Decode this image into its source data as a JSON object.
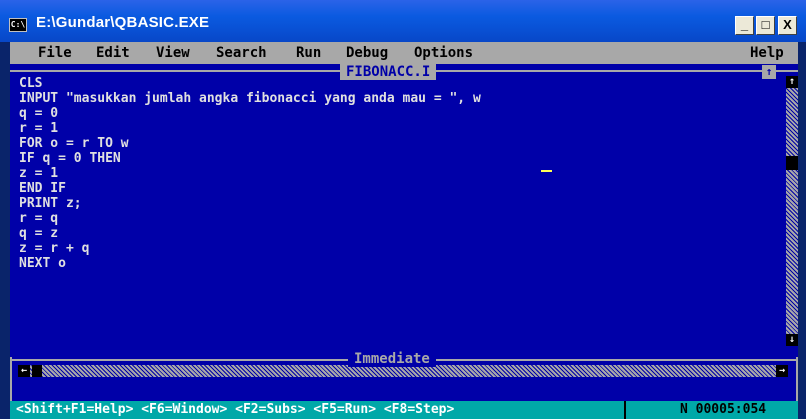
{
  "window": {
    "title": "E:\\Gundar\\QBASIC.EXE",
    "icon_text": "C:\\",
    "minimize": "_",
    "maximize": "□",
    "close": "X"
  },
  "menu": {
    "items": [
      "File",
      "Edit",
      "View",
      "Search",
      "Run",
      "Debug",
      "Options"
    ],
    "help": "Help"
  },
  "editor": {
    "filename": "FIBONACC.I",
    "maximize_glyph": "↑",
    "lines": [
      "CLS",
      "INPUT \"masukkan jumlah angka fibonacci yang anda mau = \", w",
      "q = 0",
      "r = 1",
      "FOR o = r TO w",
      "IF q = 0 THEN",
      "z = 1",
      "END IF",
      "PRINT z;",
      "r = q",
      "q = z",
      "z = r + q",
      "NEXT o"
    ],
    "scroll_up": "↑",
    "scroll_down": "↓",
    "scroll_left": "←",
    "scroll_right": "→"
  },
  "immediate": {
    "title": "Immediate"
  },
  "status": {
    "keys": "<Shift+F1=Help> <F6=Window> <F2=Subs> <F5=Run> <F8=Step>",
    "position": "N 00005:054"
  },
  "colors": {
    "background": "#0000a8",
    "menu": "#a8a8a8",
    "statusbar": "#00a8a8",
    "titlebar": "#0a5ae0"
  }
}
